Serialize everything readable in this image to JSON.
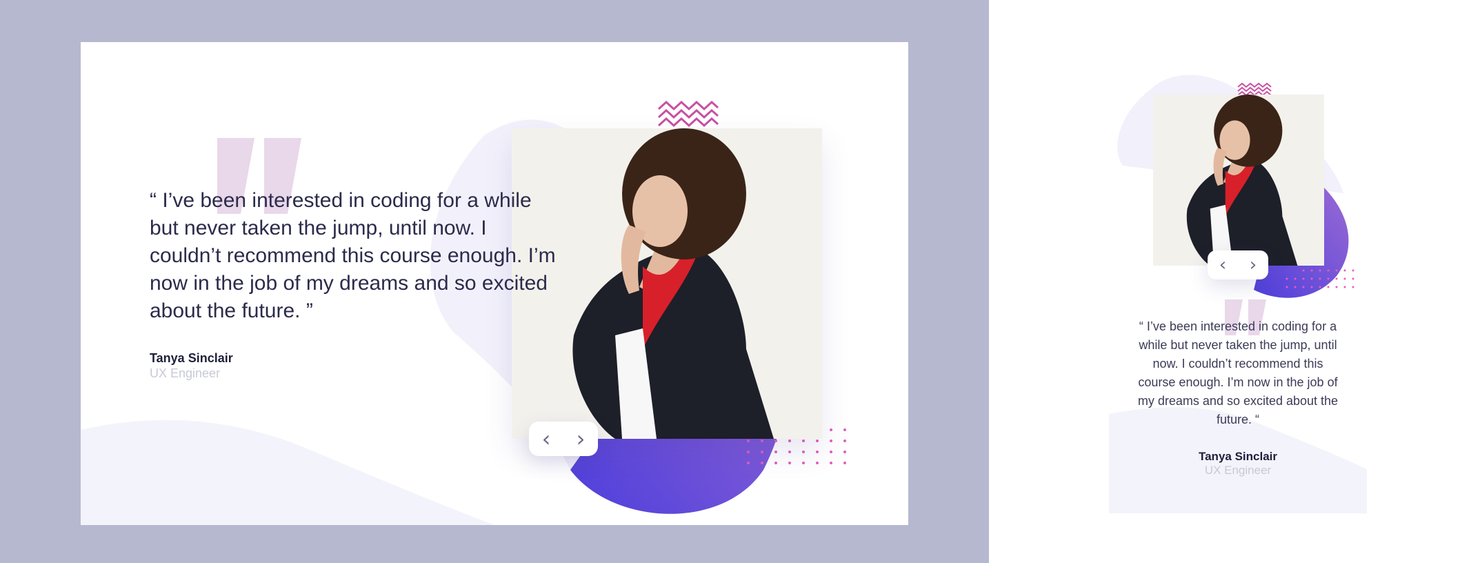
{
  "testimonial": {
    "quote": "“ I’ve been interested in coding for a while but never taken the jump, until now. I couldn’t recommend this course enough. I’m now in the job of my dreams and so excited about the future. ”",
    "mobile_quote": "“ I’ve been interested in coding for a while but never taken the jump, until now. I couldn’t recommend this course enough. I’m now in the job of my dreams and so excited about the future. “",
    "name": "Tanya Sinclair",
    "role": "UX Engineer"
  },
  "quote_mark": "❞",
  "nav": {
    "prev": "‹",
    "next": "›"
  },
  "icons": {
    "prev": "chevron-left-icon",
    "next": "chevron-right-icon"
  },
  "colors": {
    "outer_bg": "#b6b8d0",
    "quote_mark": "#e9d7ea",
    "blob": "#5b45dc",
    "wave": "#f3f3fb",
    "text": "#2b2b4b",
    "name": "#1f1f3a",
    "role": "#c8c9d6"
  }
}
